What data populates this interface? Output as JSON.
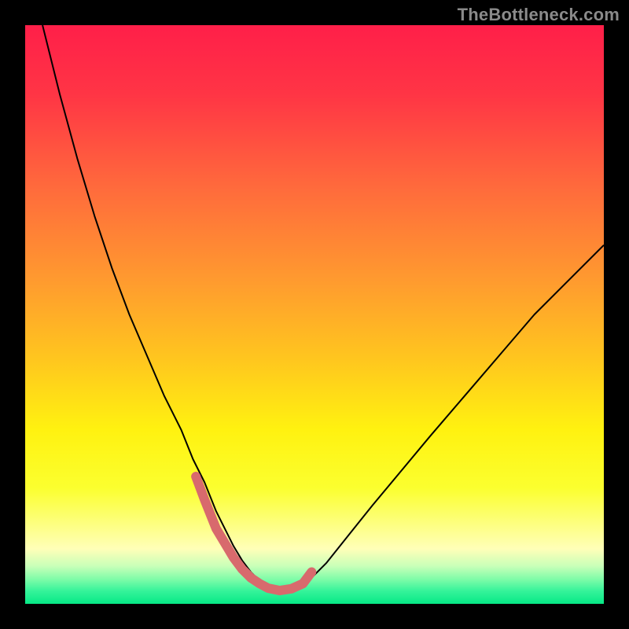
{
  "watermark": "TheBottleneck.com",
  "gradient_stops": [
    {
      "offset": 0.0,
      "color": "#ff1f49"
    },
    {
      "offset": 0.12,
      "color": "#ff3545"
    },
    {
      "offset": 0.28,
      "color": "#ff6a3c"
    },
    {
      "offset": 0.44,
      "color": "#ff9a2f"
    },
    {
      "offset": 0.58,
      "color": "#ffc71e"
    },
    {
      "offset": 0.7,
      "color": "#fff210"
    },
    {
      "offset": 0.8,
      "color": "#fbff2f"
    },
    {
      "offset": 0.865,
      "color": "#fdff84"
    },
    {
      "offset": 0.905,
      "color": "#ffffb8"
    },
    {
      "offset": 0.935,
      "color": "#c8ffb8"
    },
    {
      "offset": 0.958,
      "color": "#7dfca8"
    },
    {
      "offset": 0.978,
      "color": "#35f39a"
    },
    {
      "offset": 1.0,
      "color": "#06e986"
    }
  ],
  "chart_data": {
    "type": "line",
    "title": "",
    "xlabel": "",
    "ylabel": "",
    "xlim": [
      0,
      100
    ],
    "ylim": [
      0,
      100
    ],
    "grid": false,
    "series": [
      {
        "name": "bottleneck-curve",
        "color": "#000000",
        "width": 2,
        "x": [
          3,
          6,
          9,
          12,
          15,
          18,
          21,
          24,
          27,
          29,
          31,
          33,
          34.5,
          36,
          37.5,
          39,
          40.5,
          42,
          44,
          46,
          49,
          52,
          56,
          60,
          65,
          70,
          76,
          82,
          88,
          94,
          100
        ],
        "y": [
          100,
          88,
          77,
          67,
          58,
          50,
          43,
          36,
          30,
          25,
          21,
          16,
          13,
          10,
          7.5,
          5.5,
          4,
          3,
          2.3,
          2.6,
          4,
          7,
          12,
          17,
          23,
          29,
          36,
          43,
          50,
          56,
          62
        ]
      },
      {
        "name": "highlight-region",
        "color": "#d86a6d",
        "width": 12,
        "linecap": "round",
        "x": [
          29.5,
          31,
          33,
          34.5,
          36,
          37.5,
          39,
          40.5,
          42,
          44,
          46,
          48,
          49.5
        ],
        "y": [
          22,
          18,
          13,
          10.5,
          8,
          6,
          4.5,
          3.5,
          2.7,
          2.3,
          2.6,
          3.5,
          5.5
        ]
      }
    ],
    "annotations": []
  }
}
